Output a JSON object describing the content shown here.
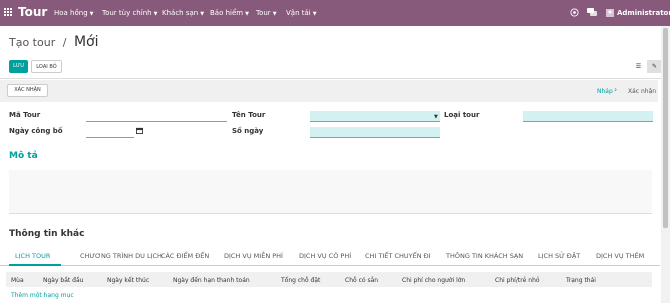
{
  "topbar": {
    "brand": "Tour",
    "menus": [
      {
        "label": "Hoa hồng"
      },
      {
        "label": "Tour tùy chỉnh"
      },
      {
        "label": "Khách sạn"
      },
      {
        "label": "Bảo hiểm"
      },
      {
        "label": "Tour"
      },
      {
        "label": "Vận tải"
      }
    ],
    "user": "Administrator"
  },
  "breadcrumb": {
    "parent": "Tạo tour",
    "separator": "/",
    "current": "Mới"
  },
  "actions": {
    "save": "LƯU",
    "discard": "LOẠI BỎ"
  },
  "statusbar": {
    "confirm": "XÁC NHẬN",
    "stages": [
      "Nháp",
      "Xác nhận"
    ]
  },
  "form": {
    "ma_tour": {
      "label": "Mã Tour",
      "value": ""
    },
    "ngay_cong_bo": {
      "label": "Ngày công bố",
      "value": ""
    },
    "ten_tour": {
      "label": "Tên Tour",
      "value": ""
    },
    "so_ngay": {
      "label": "Số ngày",
      "value": ""
    },
    "loai_tour": {
      "label": "Loại tour",
      "value": ""
    }
  },
  "sections": {
    "mo_ta": "Mô tả",
    "thong_tin_khac": "Thông tin khác"
  },
  "tabs": [
    "LỊCH TOUR",
    "CHƯƠNG TRÌNH DU LỊCH",
    "CÁC ĐIỂM ĐẾN",
    "DỊCH VỤ MIỄN PHÍ",
    "DỊCH VỤ CÓ PHÍ",
    "CHI TIẾT CHUYẾN ĐI",
    "THÔNG TIN KHÁCH SẠN",
    "LỊCH SỬ ĐẶT",
    "DỊCH VỤ THÊM"
  ],
  "table": {
    "columns": [
      "Mùa",
      "Ngày bắt đầu",
      "Ngày kết thúc",
      "Ngày đến hạn thanh toán",
      "Tổng chỗ đặt",
      "Chỗ có sẵn",
      "Chi phí cho người lớn",
      "Chi phí/trẻ nhỏ",
      "Trạng thái"
    ],
    "add_line": "Thêm một hạng mục"
  },
  "colors": {
    "topbar": "#875a7b",
    "accent": "#00a09d",
    "required_field": "#d2f1f0"
  },
  "icons": {
    "apps": "grid-icon",
    "help": "help-icon",
    "chat": "chat-icon",
    "calendar": "calendar-icon",
    "list_view": "list-icon",
    "edit_view": "edit-icon"
  }
}
